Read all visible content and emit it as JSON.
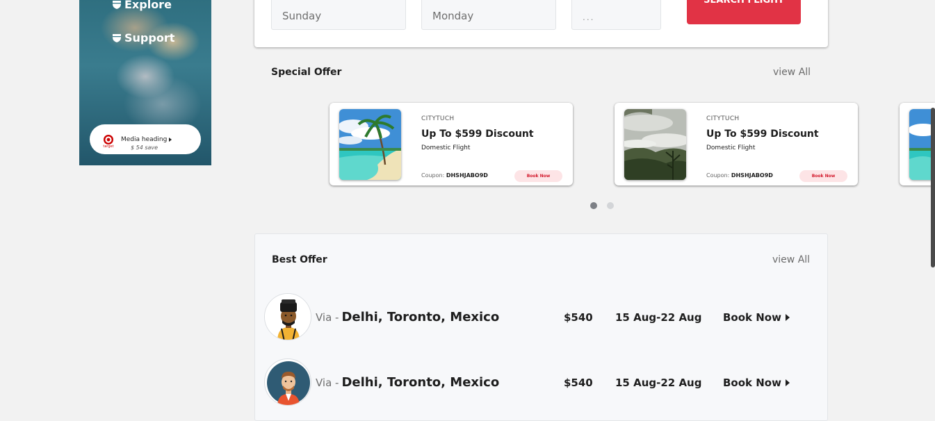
{
  "sidebar": {
    "nav": [
      {
        "label": "Explore",
        "icon": "shield-icon"
      },
      {
        "label": "Support",
        "icon": "shield-icon"
      }
    ],
    "media": {
      "logo_text": "target",
      "heading": "Media heading",
      "save": "$ 54 save"
    }
  },
  "search": {
    "fields": [
      {
        "value": "Sunday"
      },
      {
        "value": "Monday"
      },
      {
        "value": "..."
      }
    ],
    "button_label": "SEARCH FLIGHT"
  },
  "special_offer": {
    "title": "Special Offer",
    "view_all": "view All",
    "cards": [
      {
        "brand": "CITYTUCH",
        "title": "Up To $599 Discount",
        "subtitle": "Domestic Flight",
        "coupon_label": "Coupon:",
        "coupon_code": "DHSHJABO9D",
        "button": "Book Now"
      },
      {
        "brand": "CITYTUCH",
        "title": "Up To $599 Discount",
        "subtitle": "Domestic Flight",
        "coupon_label": "Coupon:",
        "coupon_code": "DHSHJABO9D",
        "button": "Book Now"
      }
    ],
    "carousel": {
      "pages": 2,
      "active": 1
    }
  },
  "best_offer": {
    "title": "Best Offer",
    "view_all": "view All",
    "rows": [
      {
        "via": "Via -",
        "destinations": "Delhi, Toronto, Mexico",
        "price": "$540",
        "dates": "15 Aug-22 Aug",
        "button": "Book Now"
      },
      {
        "via": "Via -",
        "destinations": "Delhi, Toronto, Mexico",
        "price": "$540",
        "dates": "15 Aug-22 Aug",
        "button": "Book Now"
      }
    ]
  },
  "colors": {
    "accent_red": "#e13345",
    "book_pill_bg": "#fde4e6",
    "dot_active": "#7d8086",
    "dot_inactive": "#d3d5d8"
  }
}
